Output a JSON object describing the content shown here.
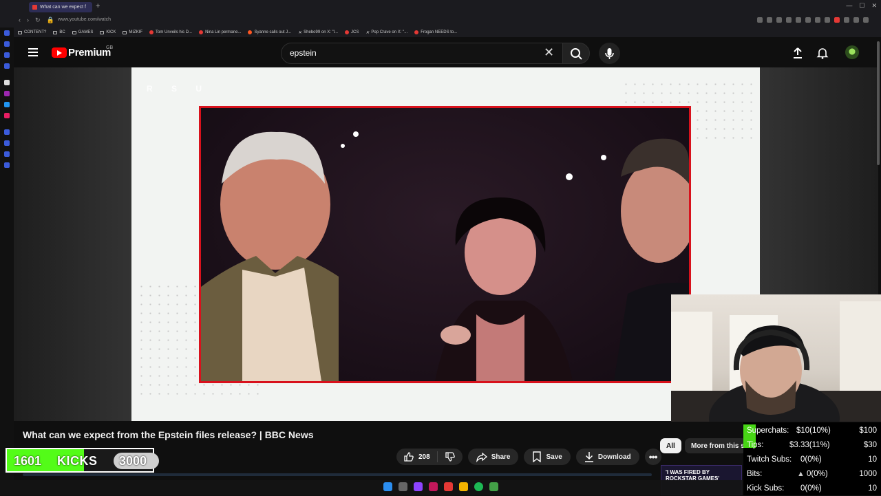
{
  "browser": {
    "tab_title": "What can we expect f",
    "new_tab": "+",
    "url": "www.youtube.com/watch",
    "bookmarks": [
      "CONTENT?",
      "BC",
      "GAMES",
      "KICK",
      "MIZKIF",
      "Tom Unveils his D...",
      "Nina Lin permane...",
      "Syanne calls out J...",
      "Shebo99 on X: \"l...",
      "JCS",
      "Pop Crave on X: \"...",
      "Frogan NEEDS to..."
    ]
  },
  "youtube": {
    "brand": "Premium",
    "region": "GB",
    "search_value": "epstein",
    "video_title": "What can we expect from the Epstein files release? | BBC News",
    "like_count": "208",
    "share_label": "Share",
    "save_label": "Save",
    "download_label": "Download",
    "chips": [
      "All",
      "More from this s"
    ],
    "suggested_thumb_text": "'I WAS FIRED BY ROCKSTAR GAMES'",
    "player_watermark": "R S U"
  },
  "kicks_overlay": {
    "count": "1601",
    "label": "KICKS",
    "goal": "3000",
    "progress": 0.53
  },
  "stats_overlay": {
    "rows": [
      {
        "label": "Superchats:",
        "value": "$10(10%)",
        "goal": "$100"
      },
      {
        "label": "Tips:",
        "value": "$3.33(11%)",
        "goal": "$30"
      },
      {
        "label": "Twitch Subs:",
        "value": "0(0%)",
        "goal": "10"
      },
      {
        "label": "Bits:",
        "value": "0(0%)",
        "goal": "1000"
      },
      {
        "label": "Kick Subs:",
        "value": "0(0%)",
        "goal": "10"
      }
    ]
  },
  "colors": {
    "youtube_red": "#ff0000",
    "frame_red": "#d8111c",
    "kick_green": "#53fc18"
  }
}
